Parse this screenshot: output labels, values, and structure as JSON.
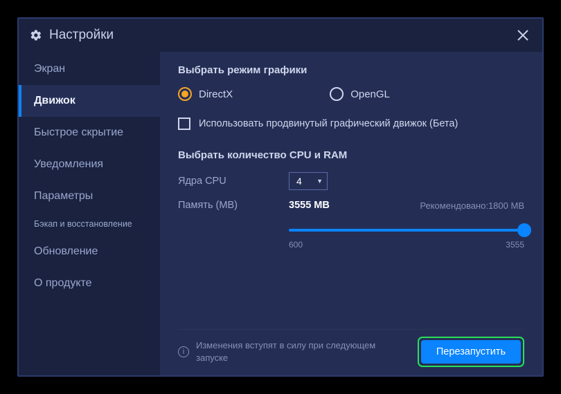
{
  "title": "Настройки",
  "sidebar": {
    "items": [
      {
        "label": "Экран"
      },
      {
        "label": "Движок"
      },
      {
        "label": "Быстрое скрытие"
      },
      {
        "label": "Уведомления"
      },
      {
        "label": "Параметры"
      },
      {
        "label": "Бэкап и восстановление"
      },
      {
        "label": "Обновление"
      },
      {
        "label": "О продукте"
      }
    ]
  },
  "content": {
    "graphics_mode_title": "Выбрать режим графики",
    "radio_directx": "DirectX",
    "radio_opengl": "OpenGL",
    "advanced_checkbox": "Использовать продвинутый графический движок (Бета)",
    "cpu_ram_title": "Выбрать количество CPU и RAM",
    "cpu_label": "Ядра CPU",
    "cpu_value": "4",
    "mem_label": "Память (MB)",
    "mem_value": "3555 MB",
    "mem_recommended": "Рекомендовано:1800 MB",
    "slider_min": "600",
    "slider_max": "3555",
    "info_text": "Изменения вступят в силу при следующем запуске",
    "restart_button": "Перезапустить"
  }
}
